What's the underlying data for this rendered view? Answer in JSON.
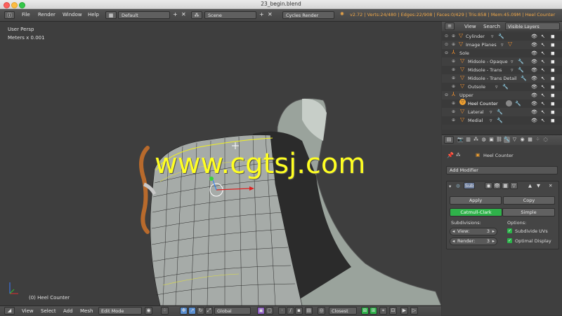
{
  "window": {
    "title": "23_begin.blend"
  },
  "info_header": {
    "menus": [
      "File",
      "Render",
      "Window",
      "Help"
    ],
    "screen_layout": "Default",
    "scene": "Scene",
    "render_engine": "Cycles Render",
    "stats": "v2.72 | Verts:24/480 | Edges:22/908 | Faces:0/429 | Tris:858 | Mem:45.09M | Heel Counter"
  },
  "viewport": {
    "view_name": "User Persp",
    "scale": "Meters x 0.001",
    "active_object": "(0) Heel Counter",
    "watermark": "www.cgtsj.com"
  },
  "bottom_header": {
    "menus": [
      "View",
      "Select",
      "Add",
      "Mesh"
    ],
    "mode": "Edit Mode",
    "orientation": "Global",
    "snap_target": "Closest"
  },
  "outliner": {
    "tabs": [
      "View",
      "Search"
    ],
    "display_mode": "Visible Layers",
    "rows": [
      {
        "label": "Cylinder",
        "indent": 1,
        "type": "object"
      },
      {
        "label": "Image Planes",
        "indent": 1,
        "type": "object"
      },
      {
        "label": "Sole",
        "indent": 0,
        "type": "empty"
      },
      {
        "label": "Midsole - Opaque",
        "indent": 2,
        "type": "object"
      },
      {
        "label": "Midsole - Trans",
        "indent": 2,
        "type": "object"
      },
      {
        "label": "Midsole - Trans Detail",
        "indent": 2,
        "type": "object"
      },
      {
        "label": "Outsole",
        "indent": 2,
        "type": "object"
      },
      {
        "label": "Upper",
        "indent": 0,
        "type": "empty"
      },
      {
        "label": "Heel Counter",
        "indent": 2,
        "type": "object-active"
      },
      {
        "label": "Lateral",
        "indent": 2,
        "type": "object"
      },
      {
        "label": "Medial",
        "indent": 2,
        "type": "object"
      }
    ]
  },
  "properties": {
    "object_name": "Heel Counter",
    "add_modifier": "Add Modifier",
    "modifier_short": "Sub",
    "apply_label": "Apply",
    "copy_label": "Copy",
    "catmull_label": "Catmull-Clark",
    "simple_label": "Simple",
    "subdivisions_label": "Subdivisions:",
    "options_label": "Options:",
    "view_label": "View:",
    "view_value": "3",
    "render_label": "Render:",
    "render_value": "3",
    "subdivide_uvs": "Subdivide UVs",
    "optimal_display": "Optimal Display"
  },
  "colors": {
    "selected_green": "#2fb24a",
    "stats_orange": "#f0a84a",
    "watermark_yellow": "#ffff22"
  }
}
